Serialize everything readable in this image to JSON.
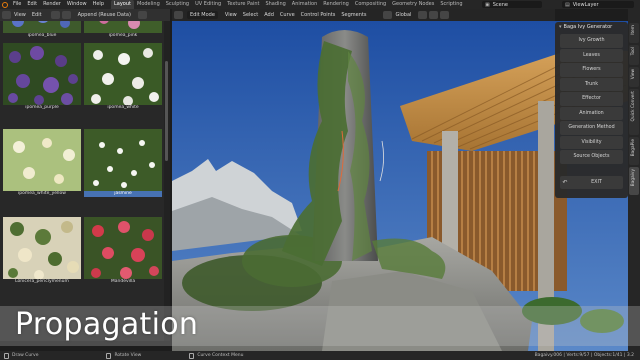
{
  "topbar": {
    "menu": [
      "File",
      "Edit",
      "Render",
      "Window",
      "Help"
    ],
    "workspaces": [
      "Layout",
      "Modeling",
      "Sculpting",
      "UV Editing",
      "Texture Paint",
      "Shading",
      "Animation",
      "Rendering",
      "Compositing",
      "Geometry Nodes",
      "Scripting"
    ],
    "active_workspace": "Layout",
    "scene": "Scene",
    "view_layer": "ViewLayer"
  },
  "image_browser": {
    "menu": [
      "View",
      "Edit"
    ],
    "append_label": "Append (Reuse Data)",
    "thumbnails": [
      {
        "label": "ipomea_blue"
      },
      {
        "label": "ipomea_pink"
      },
      {
        "label": "ipomea_purple"
      },
      {
        "label": "ipomea_white"
      },
      {
        "label": "ipomea_white_yellow"
      },
      {
        "label": "jasmine"
      },
      {
        "label": "Lonicera_periclymenum"
      },
      {
        "label": "Mandevilla"
      }
    ],
    "selected": "jasmine"
  },
  "viewport": {
    "mode": "Edit Mode",
    "menu": [
      "View",
      "Select",
      "Add",
      "Curve",
      "Control Points",
      "Segments"
    ],
    "orientation": "Global"
  },
  "addon_panel": {
    "title": "Baga Ivy Generator",
    "buttons": [
      "Ivy Growth",
      "Leaves",
      "Flowers",
      "Trunk",
      "Effector",
      "Animation",
      "Generation Method",
      "Visibility",
      "Source Objects"
    ],
    "exit_label": "EXIT"
  },
  "sidebar_tabs": [
    "Item",
    "Tool",
    "View",
    "Quick Convert",
    "BagaPie",
    "Bagaivy"
  ],
  "active_sidebar_tab": "Bagaivy",
  "caption": "Propagation",
  "statusbar": {
    "hints": [
      "Draw Curve",
      "Rotate View",
      "Curve Context Menu"
    ],
    "stats": "Bagaivy.006 | Verts:9/57 | Objects:1/41 | 3.2"
  },
  "colors": {
    "accent": "#4772b3",
    "active_tab": "#3d3d3d",
    "blender_orange": "#e87d0d",
    "sky": "#2f5fae"
  }
}
